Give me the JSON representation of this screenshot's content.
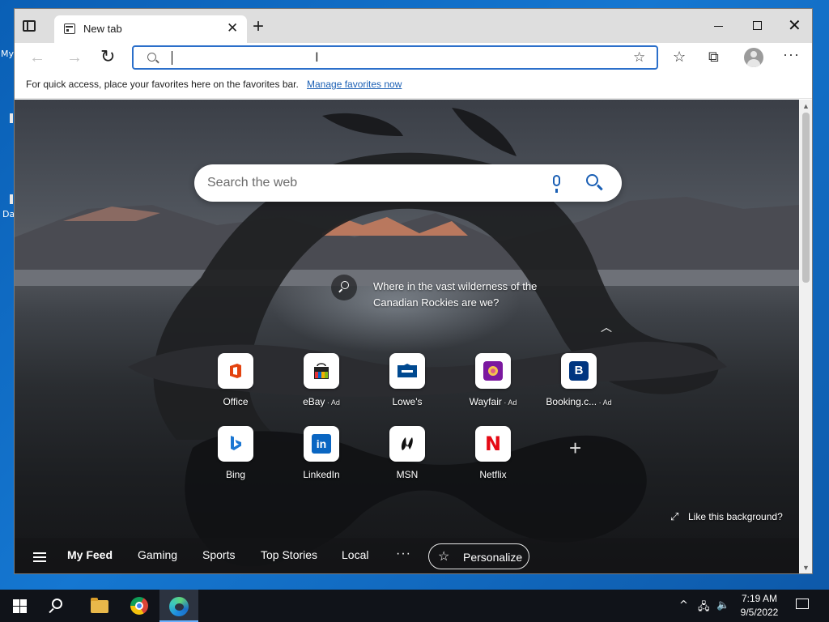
{
  "desktop": {
    "label_1": "My",
    "label_2": "Da"
  },
  "browser": {
    "tab": {
      "title": "New tab"
    },
    "address_bar": {
      "value": "",
      "placeholder": ""
    },
    "favorites_bar": {
      "message": "For quick access, place your favorites here on the favorites bar.",
      "link": "Manage favorites now"
    }
  },
  "newtab": {
    "search": {
      "placeholder": "Search the web"
    },
    "quiz": {
      "text": "Where in the vast wilderness of the Canadian Rockies are we?"
    },
    "tiles": [
      {
        "label": "Office",
        "ad": "",
        "icon": "office-icon"
      },
      {
        "label": "eBay",
        "ad": " · Ad",
        "icon": "ebay-icon"
      },
      {
        "label": "Lowe's",
        "ad": "",
        "icon": "lowes-icon"
      },
      {
        "label": "Wayfair",
        "ad": " · Ad",
        "icon": "wayfair-icon"
      },
      {
        "label": "Booking.c...",
        "ad": " · Ad",
        "icon": "booking-icon"
      },
      {
        "label": "Bing",
        "ad": "",
        "icon": "bing-icon"
      },
      {
        "label": "LinkedIn",
        "ad": "",
        "icon": "linkedin-icon"
      },
      {
        "label": "MSN",
        "ad": "",
        "icon": "msn-icon"
      },
      {
        "label": "Netflix",
        "ad": "",
        "icon": "netflix-icon"
      }
    ],
    "background_prompt": "Like this background?",
    "feed": {
      "items": [
        "My Feed",
        "Gaming",
        "Sports",
        "Top Stories",
        "Local"
      ],
      "more": "···",
      "personalize": "Personalize"
    }
  },
  "taskbar": {
    "time": "7:19 AM",
    "date": "9/5/2022"
  },
  "colors": {
    "accent": "#2b6fca",
    "link": "#1a5fb4",
    "desktop": "#1577d1",
    "taskbar": "#101319"
  }
}
